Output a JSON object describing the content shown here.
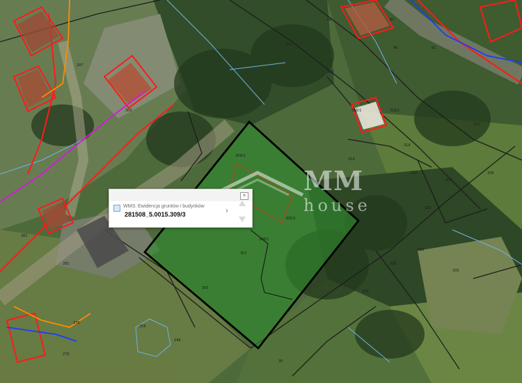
{
  "watermark": {
    "brand": "MM",
    "sub": "house"
  },
  "popup": {
    "layer_name": "WMS: Ewidencja gruntów i budynków",
    "parcel_id": "281508_5.0015.309/3",
    "chevron": "›",
    "close_symbol": "×"
  },
  "icons": {
    "close": "close-icon",
    "next": "chevron-right-icon",
    "up": "arrow-up-icon",
    "down": "arrow-down-icon"
  },
  "colors": {
    "selected_parcel_fill": "#2e8b2e",
    "selected_parcel_border": "#000000",
    "building_outline": "#ff1a1a",
    "parcel_line": "#2b2b2b",
    "road_line_orange": "#ff8c00",
    "utility_line_blue": "#1a3cff",
    "utility_line_magenta": "#d41adc",
    "cadastral_blue": "#6fb3e6"
  },
  "map_labels": [
    "309/3",
    "305",
    "308/1",
    "311",
    "297",
    "300",
    "313",
    "318/1",
    "305/2",
    "281",
    "302",
    "303",
    "30",
    "315/1",
    "320",
    "321",
    "336",
    "325",
    "86",
    "87",
    "91",
    "90",
    "276",
    "270",
    "256",
    "248",
    "329",
    "330",
    "332",
    "335",
    "318",
    "314",
    "319",
    "262"
  ]
}
